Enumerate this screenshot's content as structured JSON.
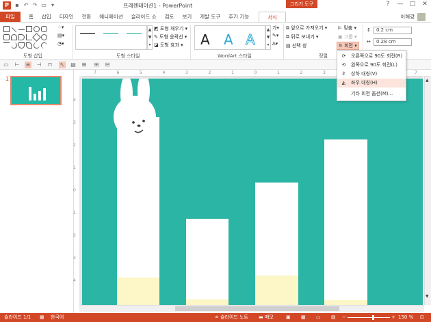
{
  "titlebar": {
    "app_letter": "P",
    "title": "프레젠테이션1 - PowerPoint",
    "context_label": "그리기 도구",
    "help": "?",
    "minimize": "—",
    "maximize": "□",
    "close": "✕"
  },
  "tabs": [
    "파일",
    "홈",
    "삽입",
    "디자인",
    "전환",
    "애니메이션",
    "슬라이드 쇼",
    "검토",
    "보기",
    "개발 도구",
    "추가 기능",
    "서식"
  ],
  "user": {
    "name": "이해강"
  },
  "ribbon": {
    "groups": {
      "insert_shapes": "도형 삽입",
      "shape_styles": "도형 스타일",
      "wordart_styles": "WordArt 스타일",
      "arrange": "정렬"
    },
    "shape_fill": "도형 채우기",
    "shape_outline": "도형 윤곽선",
    "shape_effects": "도형 효과",
    "wordart_letters": [
      "A",
      "A",
      "A"
    ],
    "bring_forward": "앞으로 가져오기",
    "send_backward": "뒤로 보내기",
    "selection_pane": "선택 창",
    "align": "맞춤",
    "group": "그룹",
    "rotate": "회전",
    "height": "0.2 cm",
    "width": "0.28 cm"
  },
  "rotate_menu": {
    "items": [
      {
        "label": "오른쪽으로 90도 회전(R)",
        "icon": "rotate-right-icon"
      },
      {
        "label": "왼쪽으로 90도 회전(L)",
        "icon": "rotate-left-icon"
      },
      {
        "label": "상하 대칭(V)",
        "icon": "flip-vertical-icon"
      },
      {
        "label": "좌우 대칭(H)",
        "icon": "flip-horizontal-icon"
      },
      {
        "label": "기타 회전 옵션(M)...",
        "icon": ""
      }
    ],
    "highlighted_index": 3
  },
  "thumbnails": [
    {
      "number": "1"
    }
  ],
  "ruler": {
    "h_ticks": [
      "7",
      "6",
      "5",
      "4",
      "3",
      "2",
      "1",
      "0",
      "1",
      "2",
      "3",
      "4",
      "5",
      "6",
      "7"
    ],
    "v_ticks": [
      "4",
      "3",
      "2",
      "1",
      "0",
      "1",
      "2",
      "3",
      "4"
    ]
  },
  "slide": {
    "background": "#2bb5a5",
    "bars": [
      {
        "level": 0.83,
        "fill": 0.12
      },
      {
        "level": 0.38,
        "fill": 0.025
      },
      {
        "level": 0.54,
        "fill": 0.13
      },
      {
        "level": 0.73,
        "fill": 0.02
      }
    ]
  },
  "statusbar": {
    "slide_info": "슬라이드 1/1",
    "language": "한국어",
    "notes": "슬라이드 노트",
    "comments": "메모",
    "zoom": "150 %"
  },
  "colors": {
    "accent": "#d24726",
    "slide": "#2bb5a5",
    "bar_fill": "#fdf6c6"
  }
}
